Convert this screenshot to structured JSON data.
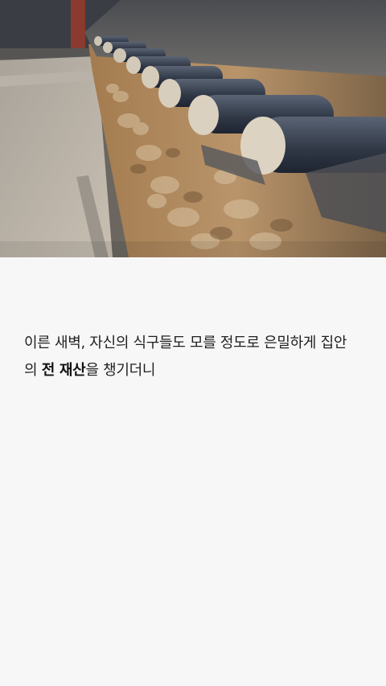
{
  "photo": {
    "subject": "traditional korean stone wall with roof tiles"
  },
  "caption": {
    "line1": "이른 새벽, 자신의 식구들도 모를 정도로 은밀하게 집안",
    "line2_prefix": "의 ",
    "line2_bold": "전 재산",
    "line2_suffix": "을 챙기더니"
  }
}
